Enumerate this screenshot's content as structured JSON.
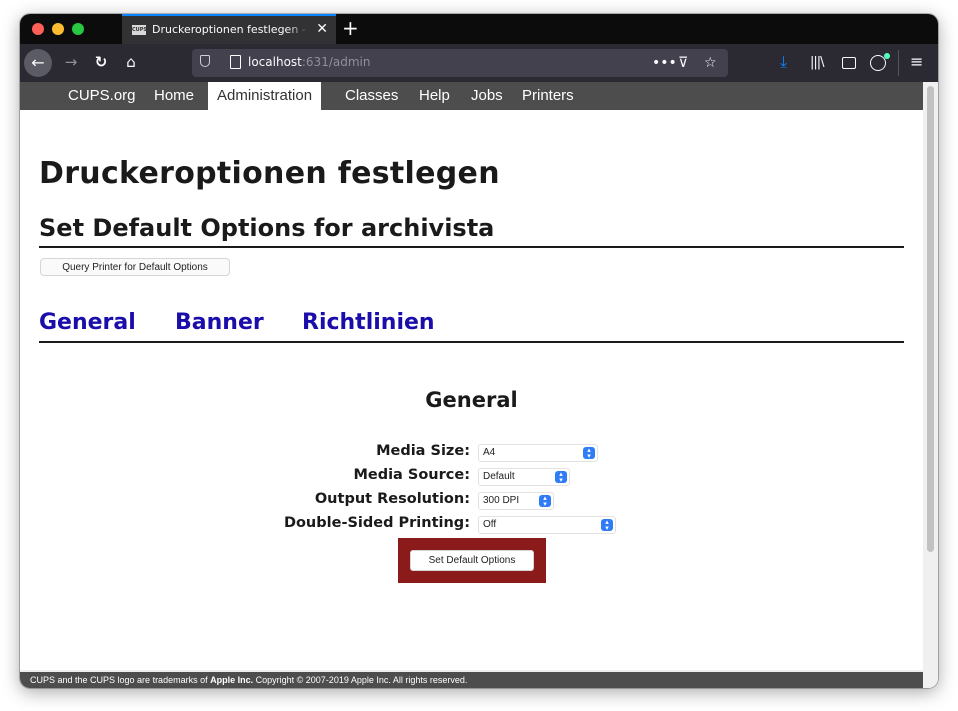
{
  "browser": {
    "tab_title": "Druckeroptionen festlegen - CUPS",
    "tab_favicon_text": "CUPS",
    "url_host": "localhost",
    "url_rest": ":631/admin",
    "accent_color": "#0a84ff"
  },
  "nav": {
    "items": [
      {
        "label": "CUPS.org"
      },
      {
        "label": "Home"
      },
      {
        "label": "Administration"
      },
      {
        "label": "Classes"
      },
      {
        "label": "Help"
      },
      {
        "label": "Jobs"
      },
      {
        "label": "Printers"
      }
    ],
    "active": "Administration"
  },
  "page": {
    "title": "Druckeroptionen festlegen",
    "subtitle": "Set Default Options for archivista",
    "query_button": "Query Printer for Default Options",
    "tabs": [
      {
        "label": "General"
      },
      {
        "label": "Banner"
      },
      {
        "label": "Richtlinien"
      }
    ],
    "section_title": "General",
    "options": [
      {
        "label": "Media Size:",
        "value": "A4"
      },
      {
        "label": "Media Source:",
        "value": "Default"
      },
      {
        "label": "Output Resolution:",
        "value": "300 DPI"
      },
      {
        "label": "Double-Sided Printing:",
        "value": "Off"
      }
    ],
    "submit_button": "Set Default Options"
  },
  "footer": {
    "prefix": "CUPS and the CUPS logo are trademarks of",
    "company": "Apple Inc.",
    "suffix": "Copyright © 2007-2019 Apple Inc. All rights reserved."
  }
}
